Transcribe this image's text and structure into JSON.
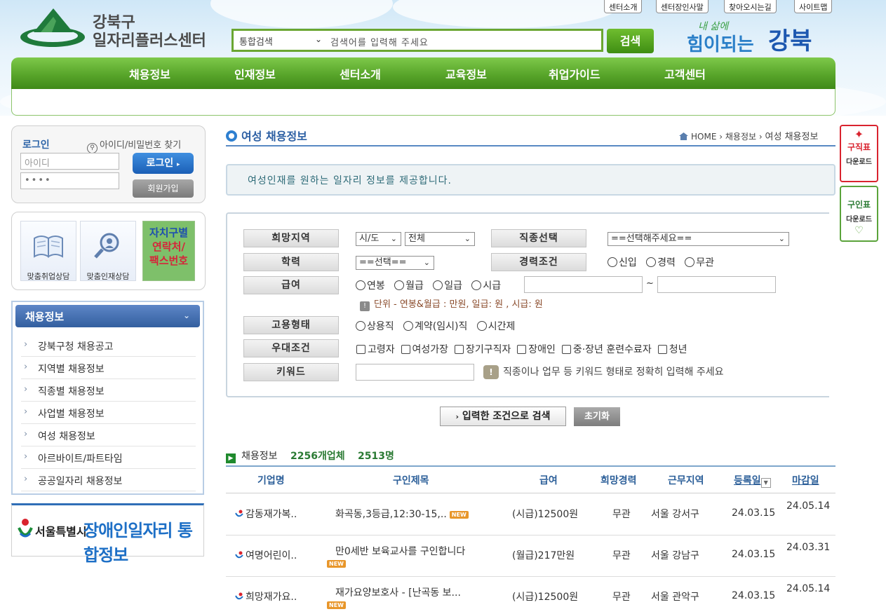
{
  "header": {
    "logo_line1": "강북구",
    "logo_line2": "일자리플러스센터",
    "utility_links": [
      "센터소개",
      "센터장인사말",
      "찾아오시는길",
      "사이트맵"
    ],
    "search": {
      "category": "통합검색",
      "placeholder": "검색어를 입력해 주세요",
      "button": "검색"
    },
    "slogan": "힘이되는 강북"
  },
  "nav": {
    "items": [
      "채용정보",
      "인재정보",
      "센터소개",
      "교육정보",
      "취업가이드",
      "고객센터"
    ]
  },
  "login": {
    "title": "로그인",
    "find_link": "아이디/비밀번호 찾기",
    "id_placeholder": "아이디",
    "pw_value": "••••",
    "login_button": "로그인",
    "join_button": "회원가입"
  },
  "quick": {
    "item1": "맞춤취업상담",
    "item2": "맞춤인재상담",
    "green_line1": "자치구별",
    "green_line2": "연락처/",
    "green_line3": "팩스번호"
  },
  "side_menu": {
    "title": "채용정보",
    "items": [
      "강북구청 채용공고",
      "지역별 채용정보",
      "직종별 채용정보",
      "사업별 채용정보",
      "여성 채용정보",
      "아르바이트/파트타임",
      "공공일자리 채용정보"
    ]
  },
  "seoul_banner": {
    "prefix": "서울특별시",
    "main": "장애인일자리 통합정보"
  },
  "page": {
    "title": "여성 채용정보",
    "breadcrumb_home": "HOME",
    "breadcrumb_1": "채용정보",
    "breadcrumb_2": "여성 채용정보",
    "intro": "여성인재를 원하는 일자리 정보를 제공합니다."
  },
  "form": {
    "region_label": "희망지역",
    "region_sido": "시/도",
    "region_all": "전체",
    "job_label": "직종선택",
    "job_value": "==선택해주세요==",
    "edu_label": "학력",
    "edu_value": "==선택==",
    "career_label": "경력조건",
    "career_options": [
      "신입",
      "경력",
      "무관"
    ],
    "salary_label": "급여",
    "salary_options": [
      "연봉",
      "월급",
      "일급",
      "시급"
    ],
    "salary_tilde": "~",
    "salary_note": "단위 - 연봉&월급 : 만원, 일급: 원 , 시급: 원",
    "employ_label": "고용형태",
    "employ_options": [
      "상용직",
      "계약(임시)직",
      "시간제"
    ],
    "pref_label": "우대조건",
    "pref_options": [
      "고령자",
      "여성가장",
      "장기구직자",
      "장애인",
      "중·장년 훈련수료자",
      "청년"
    ],
    "keyword_label": "키워드",
    "keyword_hint": "직종이나 업무 등 키워드 형태로 정확히 입력해 주세요",
    "search_button": "입력한 조건으로 검색",
    "reset_button": "초기화"
  },
  "list": {
    "title": "채용정보",
    "company_count": "2256개업체",
    "people_count": "2513명",
    "headers": [
      "기업명",
      "구인제목",
      "급여",
      "희망경력",
      "근무지역",
      "등록일",
      "마감일"
    ],
    "rows": [
      {
        "company": "감동재가복..",
        "title": "화곡동,3등급,12:30-15,..",
        "salary": "(시급)12500원",
        "career": "무관",
        "region": "서울 강서구",
        "registered": "24.03.15",
        "deadline": "24.05.14"
      },
      {
        "company": "여명어린이..",
        "title": "만0세반 보육교사를 구인합니다",
        "salary": "(월급)217만원",
        "career": "무관",
        "region": "서울 강남구",
        "registered": "24.03.15",
        "deadline": "24.03.31"
      },
      {
        "company": "희망재가요..",
        "title": "재가요양보호사 - [난곡동 보...",
        "salary": "(시급)12500원",
        "career": "무관",
        "region": "서울 관악구",
        "registered": "24.03.15",
        "deadline": "24.05.14"
      }
    ],
    "new_badge": "NEW"
  },
  "side_banners": {
    "b1_line1": "구직표",
    "b1_line2": "다운로드",
    "b2_line1": "구인표",
    "b2_line2": "다운로드"
  },
  "colors": {
    "nav_green": "#58a52a",
    "title_blue": "#2c5fa3",
    "count_green": "#2a7a33"
  }
}
